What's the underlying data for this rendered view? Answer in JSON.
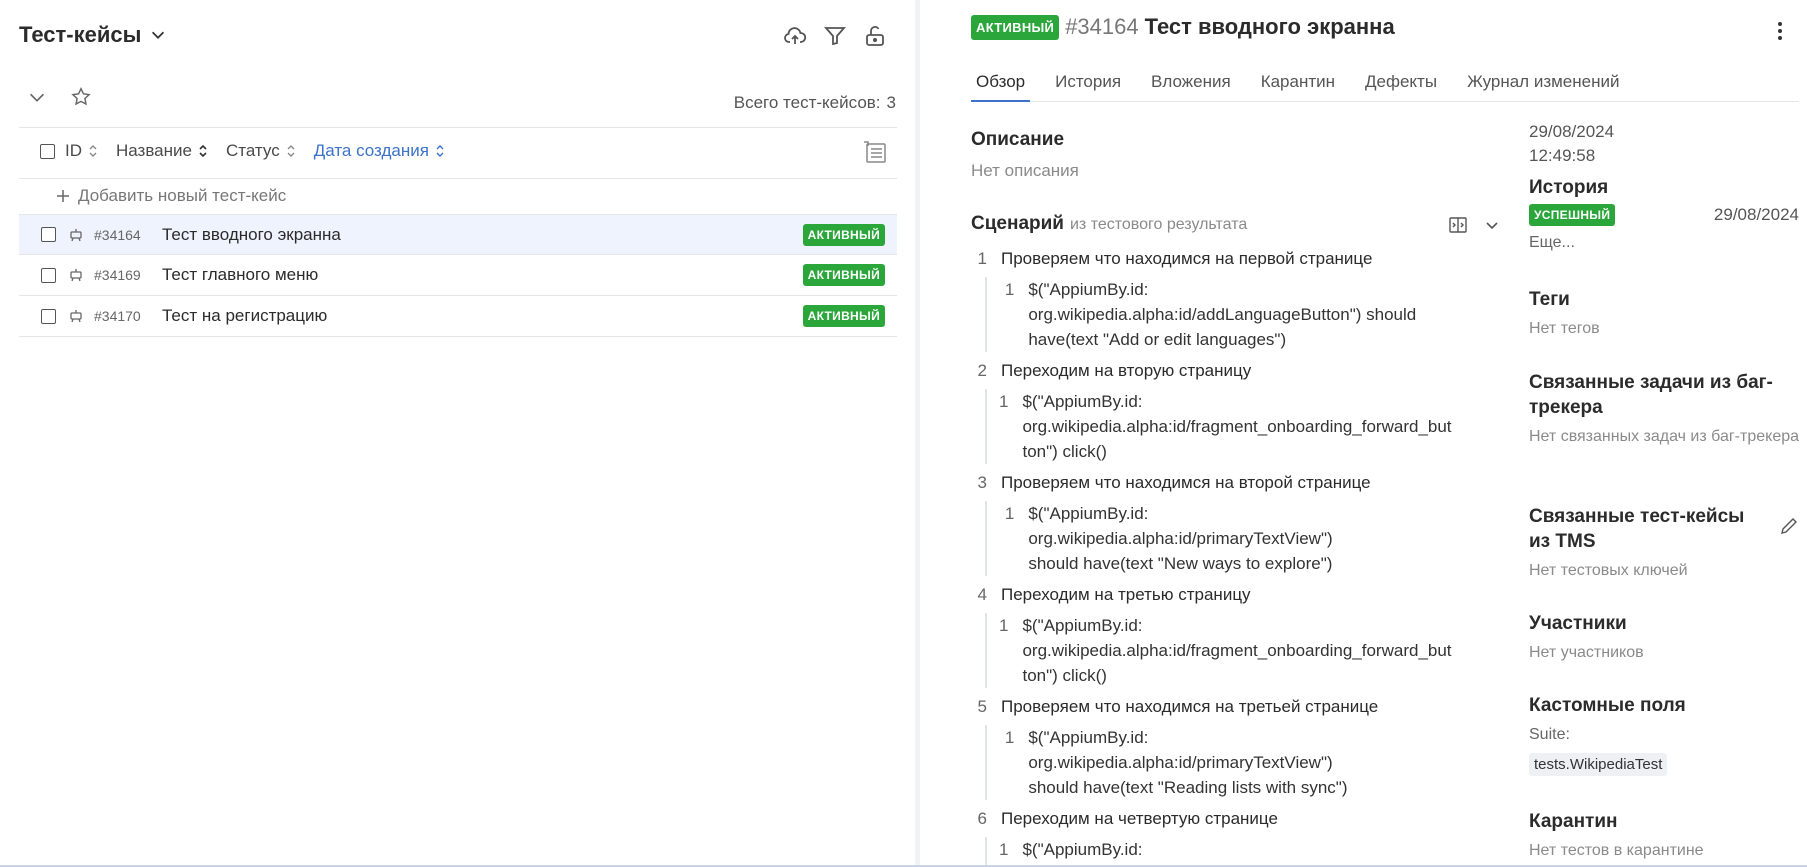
{
  "left": {
    "title": "Тест-кейсы",
    "total_label": "Всего тест-кейсов:",
    "total_count": "3",
    "columns": [
      "ID",
      "Название",
      "Статус",
      "Дата создания"
    ],
    "add_label": "Добавить новый тест-кейс",
    "rows": [
      {
        "id": "#34164",
        "name": "Тест вводного экранна",
        "status": "АКТИВНЫЙ"
      },
      {
        "id": "#34169",
        "name": "Тест главного меню",
        "status": "АКТИВНЫЙ"
      },
      {
        "id": "#34170",
        "name": "Тест на регистрацию",
        "status": "АКТИВНЫЙ"
      }
    ]
  },
  "right": {
    "status": "АКТИВНЫЙ",
    "id": "#34164",
    "title": "Тест вводного экранна",
    "tabs": [
      "Обзор",
      "История",
      "Вложения",
      "Карантин",
      "Дефекты",
      "Журнал изменений"
    ],
    "description_h": "Описание",
    "description": "Нет описания",
    "scenario_h": "Сценарий",
    "scenario_sub": "из тестового результата",
    "steps": [
      {
        "n": "1",
        "text": "Проверяем что находимся на первой странице",
        "sub": "$(\"AppiumBy.id:\norg.wikipedia.alpha:id/addLanguageButton\") should\nhave(text \"Add or edit languages\")"
      },
      {
        "n": "2",
        "text": "Переходим на вторую страницу",
        "sub": "$(\"AppiumBy.id:\norg.wikipedia.alpha:id/fragment_onboarding_forward_but\nton\") click()"
      },
      {
        "n": "3",
        "text": "Проверяем что находимся на второй странице",
        "sub": "$(\"AppiumBy.id: org.wikipedia.alpha:id/primaryTextView\")\nshould have(text \"New ways to explore\")"
      },
      {
        "n": "4",
        "text": "Переходим на третью страницу",
        "sub": "$(\"AppiumBy.id:\norg.wikipedia.alpha:id/fragment_onboarding_forward_but\nton\") click()"
      },
      {
        "n": "5",
        "text": "Проверяем что находимся на третьей странице",
        "sub": "$(\"AppiumBy.id: org.wikipedia.alpha:id/primaryTextView\")\nshould have(text \"Reading lists with sync\")"
      },
      {
        "n": "6",
        "text": "Переходим на четвертую странице",
        "sub": "$(\"AppiumBy.id:\norg.wikipedia.alpha:id/fragment_onboarding_forward_but"
      }
    ],
    "side": {
      "created_date": "29/08/2024",
      "created_time": "12:49:58",
      "history_h": "История",
      "history_status": "УСПЕШНЫЙ",
      "history_date": "29/08/2024",
      "history_more": "Еще...",
      "tags_h": "Теги",
      "tags": "Нет тегов",
      "issues_h": "Связанные задачи из баг-трекера",
      "issues": "Нет связанных задач из баг-трекера",
      "linked_h": "Связанные тест-кейсы из TMS",
      "linked": "Нет тестовых ключей",
      "members_h": "Участники",
      "members": "Нет участников",
      "custom_h": "Кастомные поля",
      "suite_label": "Suite:",
      "suite_value": "tests.WikipediaTest",
      "quarantine_h": "Карантин",
      "quarantine": "Нет тестов в карантине"
    }
  },
  "colors": {
    "accent": "#3c72c8",
    "badge_green": "#2aa63a",
    "selected_row": "#eef3fd"
  }
}
